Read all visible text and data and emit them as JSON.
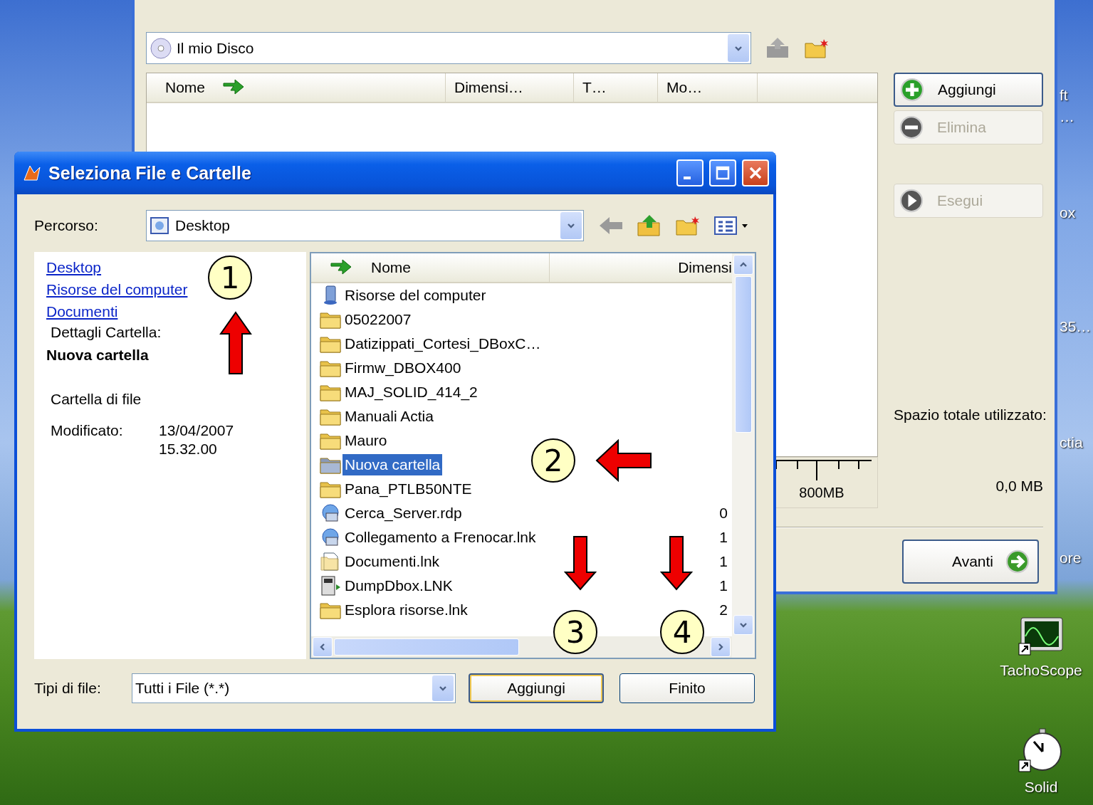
{
  "desktop": {
    "partial_labels": [
      "ft",
      "…",
      "ox",
      "35…",
      "ctia",
      "ore"
    ],
    "icons": [
      {
        "label": "TachoScope",
        "kind": "scope"
      },
      {
        "label": "Solid",
        "kind": "stopwatch"
      }
    ]
  },
  "main_window": {
    "location": "Il mio Disco",
    "columns": [
      "Nome",
      "Dimensi…",
      "T…",
      "Mo…"
    ],
    "buttons": [
      {
        "label": "Aggiungi",
        "kind": "add",
        "disabled": false,
        "focused": true
      },
      {
        "label": "Elimina",
        "kind": "remove",
        "disabled": true,
        "focused": false
      },
      {
        "label": "Esegui",
        "kind": "run",
        "disabled": true,
        "focused": false
      }
    ],
    "ruler_label": "800MB",
    "total_label": "Spazio totale utilizzato:",
    "total_value": "0,0 MB",
    "next_button": "Avanti"
  },
  "dialog": {
    "title": "Seleziona File e Cartelle",
    "path_label": "Percorso:",
    "path_value": "Desktop",
    "places": [
      "Desktop",
      "Risorse del computer",
      "Documenti"
    ],
    "details": {
      "heading": "Dettagli Cartella:",
      "name": "Nuova cartella",
      "type": "Cartella di file",
      "modified_label": "Modificato:",
      "modified_date": "13/04/2007",
      "modified_time": "15.32.00"
    },
    "columns": [
      "Nome",
      "Dimensi"
    ],
    "files": [
      {
        "name": "Risorse del computer",
        "kind": "computer",
        "selected": false
      },
      {
        "name": "05022007",
        "kind": "folder",
        "selected": false
      },
      {
        "name": "Datizippati_Cortesi_DBoxC…",
        "kind": "folder",
        "selected": false
      },
      {
        "name": "Firmw_DBOX400",
        "kind": "folder",
        "selected": false
      },
      {
        "name": "MAJ_SOLID_414_2",
        "kind": "folder",
        "selected": false
      },
      {
        "name": "Manuali Actia",
        "kind": "folder",
        "selected": false
      },
      {
        "name": "Mauro",
        "kind": "folder",
        "selected": false
      },
      {
        "name": "Nuova cartella",
        "kind": "folder",
        "selected": true
      },
      {
        "name": "Pana_PTLB50NTE",
        "kind": "folder",
        "selected": false
      },
      {
        "name": "Cerca_Server.rdp",
        "kind": "network",
        "size": "0",
        "selected": false
      },
      {
        "name": "Collegamento a Frenocar.lnk",
        "kind": "network",
        "size": "1",
        "selected": false
      },
      {
        "name": "Documenti.lnk",
        "kind": "document",
        "size": "1",
        "selected": false
      },
      {
        "name": "DumpDbox.LNK",
        "kind": "program",
        "size": "1",
        "selected": false
      },
      {
        "name": "Esplora risorse.lnk",
        "kind": "folder",
        "size": "2",
        "selected": false
      }
    ],
    "filetype_label": "Tipi di file:",
    "filetype_value": "Tutti i File (*.*)",
    "buttons": [
      "Aggiungi",
      "Finito"
    ]
  },
  "annotations": [
    {
      "label": "1",
      "kind": "up"
    },
    {
      "label": "2",
      "kind": "left"
    },
    {
      "label": "3",
      "kind": "down"
    },
    {
      "label": "4",
      "kind": "down"
    }
  ]
}
